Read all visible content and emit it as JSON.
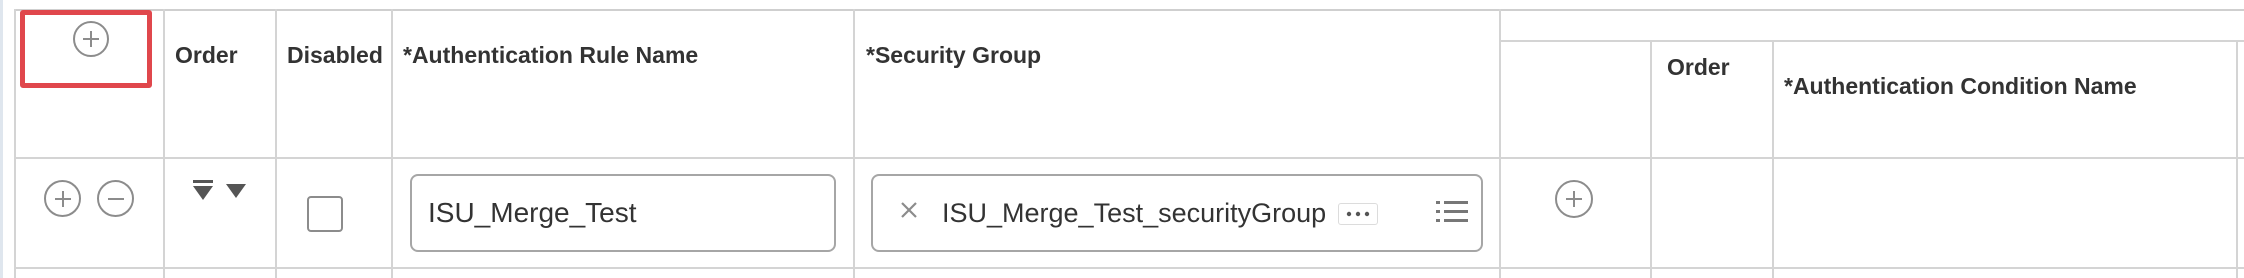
{
  "colors": {
    "highlight_border": "#e0474c",
    "grid_line": "#d4d4d4",
    "icon_gray": "#8c8c8c",
    "text": "#333333"
  },
  "table": {
    "columns": {
      "order": "Order",
      "disabled": "Disabled",
      "rule_name": "*Authentication Rule Name",
      "security_group": "*Security Group"
    },
    "nested_columns": {
      "order": "Order",
      "condition_name": "*Authentication Condition Name"
    },
    "header_icons": {
      "add_row": "plus-circle-icon"
    },
    "rows": [
      {
        "row_icons": [
          "plus-circle-icon",
          "minus-circle-icon",
          "sort-down-icon"
        ],
        "disabled": false,
        "rule_name": "ISU_Merge_Test",
        "security_group": {
          "selected_value": "ISU_Merge_Test_securityGroup",
          "remove_icon": "close-icon",
          "more_icon": "ellipsis-icon",
          "prompt_icon": "list-icon"
        },
        "nested_add_icon": "plus-circle-icon"
      }
    ]
  }
}
